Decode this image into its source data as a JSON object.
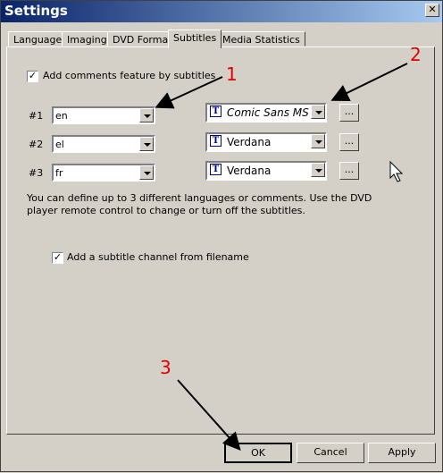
{
  "window": {
    "title": "Settings",
    "close_label": "✕"
  },
  "tabs": [
    {
      "label": "Language"
    },
    {
      "label": "Imaging"
    },
    {
      "label": "DVD Format"
    },
    {
      "label": "Subtitles"
    },
    {
      "label": "Media Statistics"
    }
  ],
  "active_tab": "Subtitles",
  "subtitles": {
    "add_comments": {
      "label": "Add comments feature by subtitles",
      "checked": true,
      "mark": "✓"
    },
    "rows": [
      {
        "num": "#1",
        "language": "en",
        "font": "Comic Sans MS",
        "dots": "..."
      },
      {
        "num": "#2",
        "language": "el",
        "font": "Verdana",
        "dots": "..."
      },
      {
        "num": "#3",
        "language": "fr",
        "font": "Verdana",
        "dots": "..."
      }
    ],
    "font_icon": "T",
    "info_line1": "You can define up to 3 different languages or comments. Use the DVD",
    "info_line2": "player remote control to change or turn off the subtitles.",
    "add_channel": {
      "label": "Add a subtitle channel from filename",
      "checked": true,
      "mark": "✓"
    }
  },
  "buttons": {
    "ok": "OK",
    "cancel": "Cancel",
    "apply": "Apply"
  },
  "annotations": [
    "1",
    "2",
    "3"
  ],
  "colors": {
    "annotation": "#e00000",
    "titlebar_start": "#0a246a",
    "titlebar_end": "#a6caf0"
  }
}
